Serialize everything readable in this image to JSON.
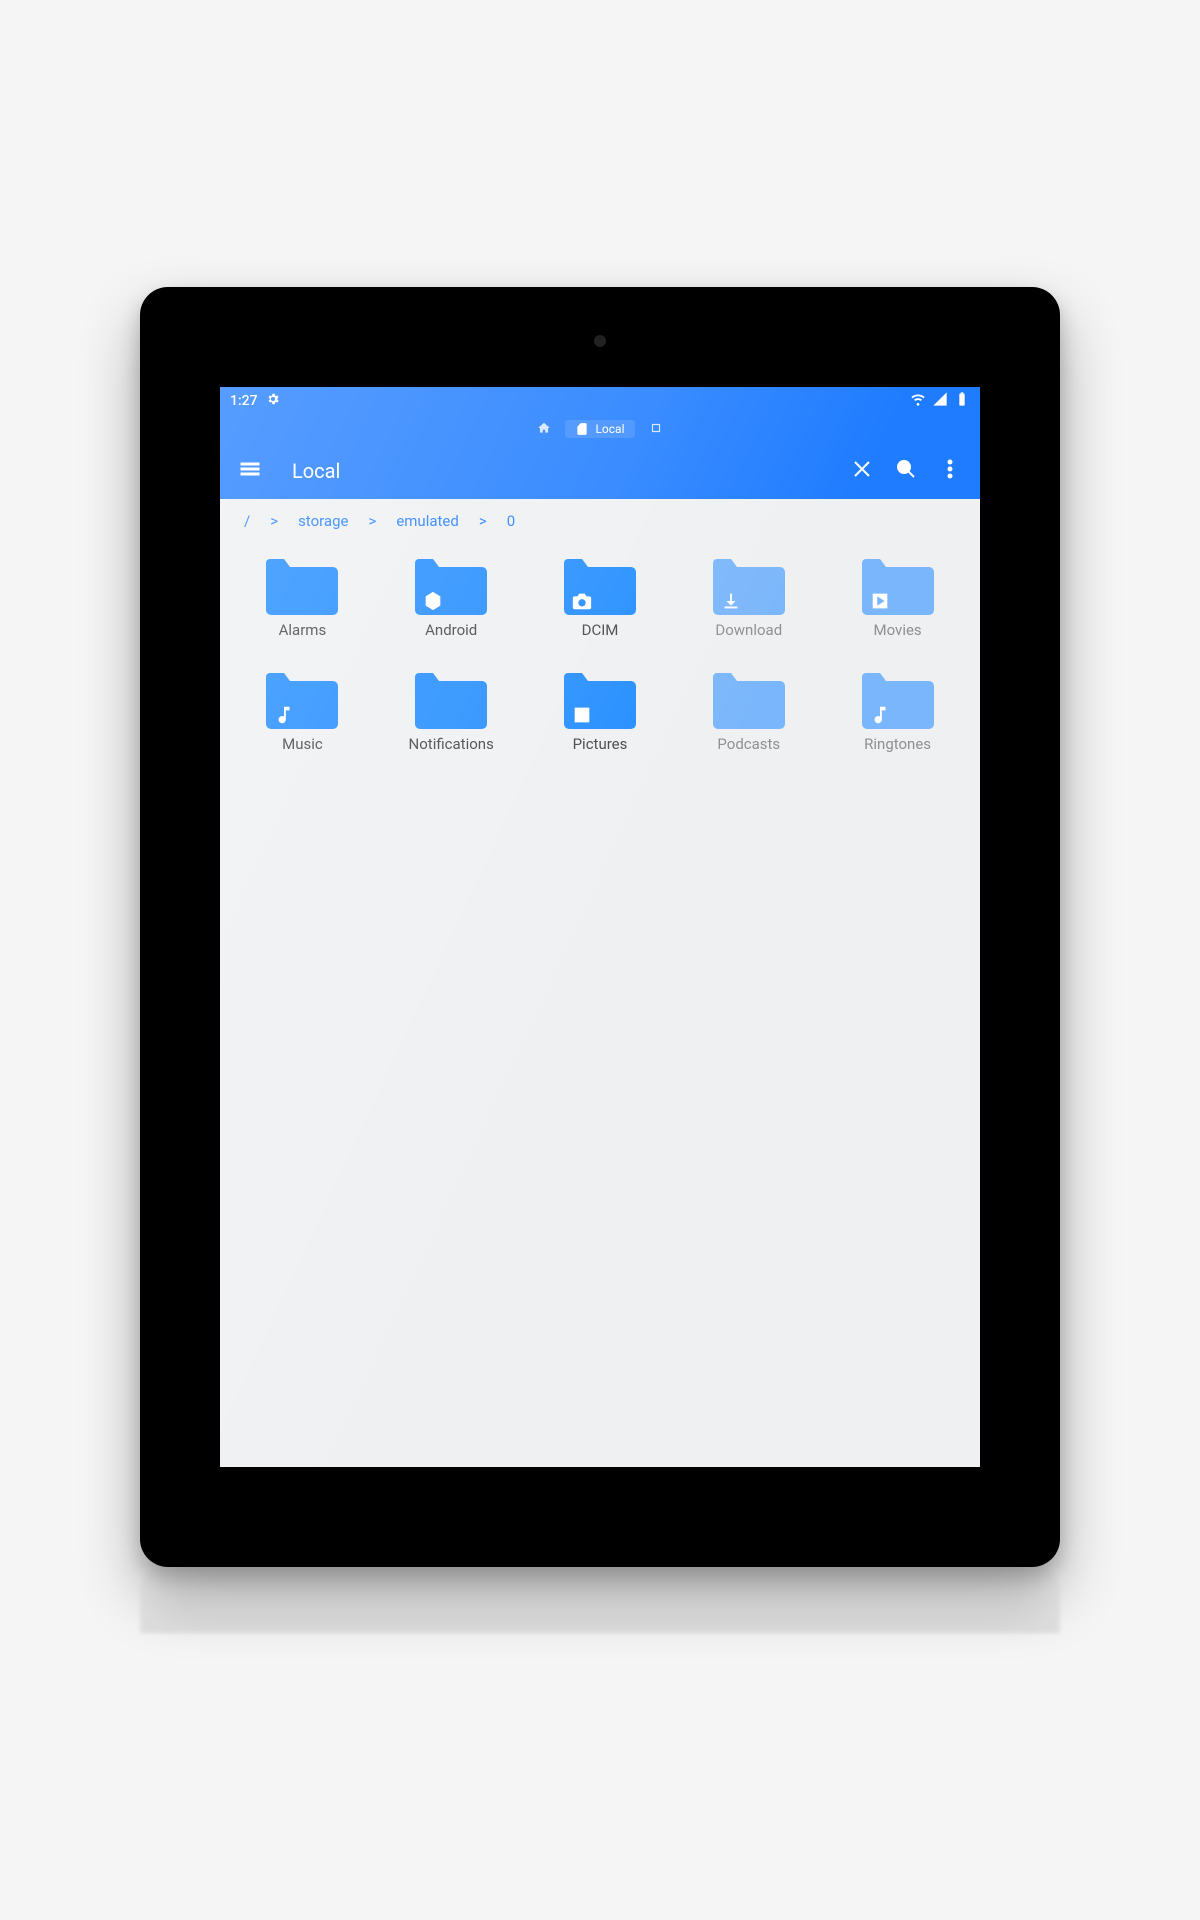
{
  "status_bar": {
    "time": "1:27",
    "settings_icon": "gear",
    "right_icons": [
      "wifi",
      "signal",
      "battery"
    ]
  },
  "tabstrip": {
    "home_icon": "home",
    "active_tab_label": "Local",
    "new_tab_icon": "plus"
  },
  "app_bar": {
    "title": "Local",
    "menu_icon": "hamburger",
    "close_icon": "close",
    "search_icon": "search",
    "more_icon": "more-vert"
  },
  "breadcrumb": {
    "segments": [
      "/",
      ">",
      "storage",
      ">",
      "emulated",
      ">",
      "0"
    ]
  },
  "folders": [
    {
      "name": "Alarms",
      "overlay": null,
      "dim": false
    },
    {
      "name": "Android",
      "overlay": "hexagon",
      "dim": false
    },
    {
      "name": "DCIM",
      "overlay": "camera",
      "dim": false
    },
    {
      "name": "Download",
      "overlay": "download",
      "dim": true
    },
    {
      "name": "Movies",
      "overlay": "play",
      "dim": true
    },
    {
      "name": "Music",
      "overlay": "music",
      "dim": false
    },
    {
      "name": "Notifications",
      "overlay": null,
      "dim": false
    },
    {
      "name": "Pictures",
      "overlay": "image",
      "dim": false
    },
    {
      "name": "Podcasts",
      "overlay": null,
      "dim": true
    },
    {
      "name": "Ringtones",
      "overlay": "music",
      "dim": true
    }
  ],
  "colors": {
    "accent": "#1f7cff",
    "folder": "#1f8bff",
    "folder_dim": "#7ab6fb",
    "bg": "#eef0f2"
  }
}
